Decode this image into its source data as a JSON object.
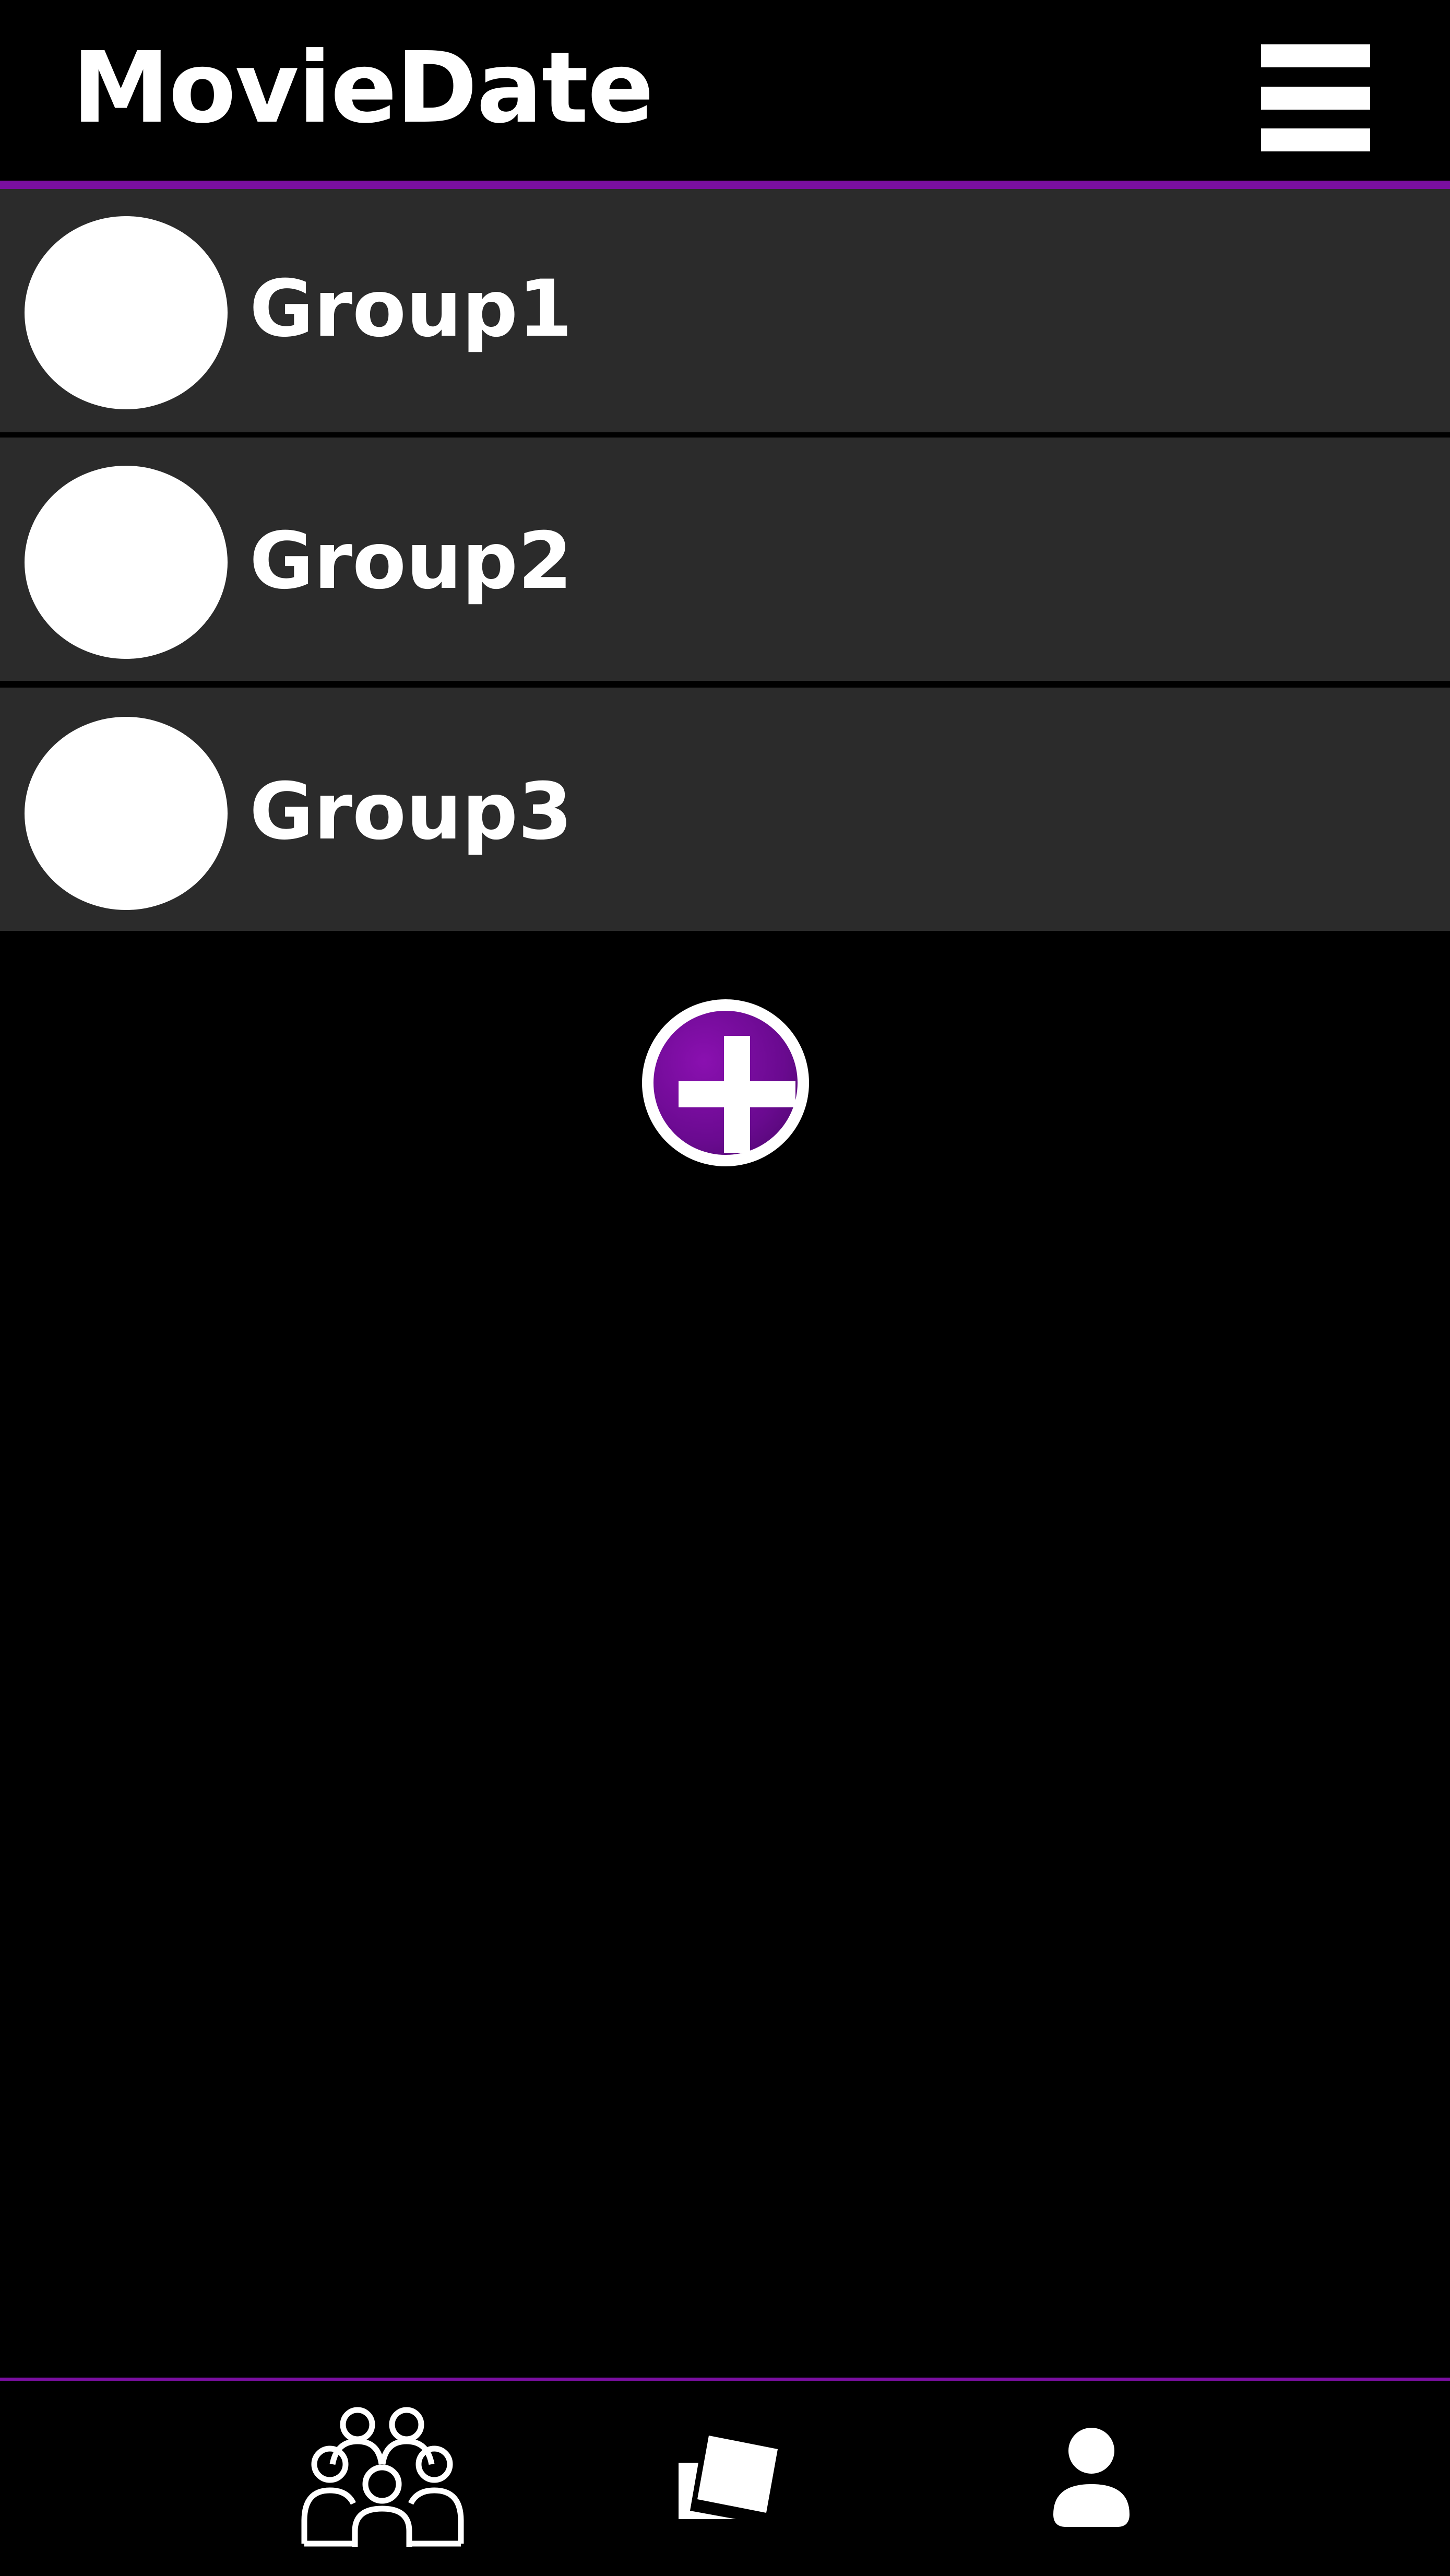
{
  "header": {
    "title": "MovieDate",
    "menu_icon": "hamburger-menu-icon"
  },
  "groups": [
    {
      "name": "Group1",
      "avatar_icon": "group-avatar"
    },
    {
      "name": "Group2",
      "avatar_icon": "group-avatar"
    },
    {
      "name": "Group3",
      "avatar_icon": "group-avatar"
    }
  ],
  "add_group": {
    "icon": "plus-icon"
  },
  "bottom_nav": {
    "items": [
      {
        "icon": "groups-icon"
      },
      {
        "icon": "cards-icon"
      },
      {
        "icon": "profile-icon"
      }
    ]
  },
  "colors": {
    "background": "#000000",
    "accent": "#7a0fa0",
    "row_background": "#2b2b2b",
    "text": "#ffffff"
  }
}
